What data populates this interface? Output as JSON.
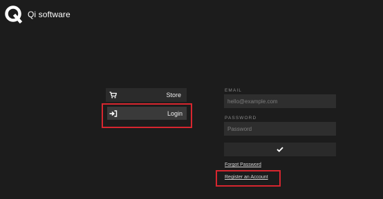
{
  "header": {
    "brand_name": "Qi software",
    "logo_icon": "qi-logo-icon"
  },
  "nav": {
    "items": [
      {
        "label": "Store",
        "icon": "cart-icon"
      },
      {
        "label": "Login",
        "icon": "sign-in-icon"
      }
    ]
  },
  "form": {
    "email_label": "EMAIL",
    "email_placeholder": "hello@example.com",
    "email_value": "",
    "password_label": "PASSWORD",
    "password_placeholder": "Password",
    "password_value": "",
    "submit_icon": "checkmark-icon",
    "forgot_link": "Forgot Password",
    "register_link": "Register an Account"
  },
  "colors": {
    "background": "#1c1c1c",
    "highlight": "#d8262f"
  }
}
